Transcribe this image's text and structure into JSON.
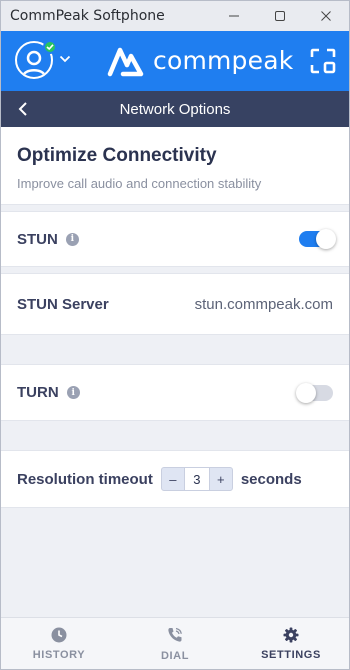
{
  "window": {
    "title": "CommPeak Softphone"
  },
  "header": {
    "brand_name": "commpeak",
    "avatar_icon": "user-avatar-icon",
    "status_color": "#29c45d",
    "accent_color": "#1f7ef0"
  },
  "nav": {
    "title": "Network Options",
    "bar_color": "#374262"
  },
  "intro": {
    "title": "Optimize Connectivity",
    "subtitle": "Improve call audio and connection stability"
  },
  "settings": {
    "stun": {
      "label": "STUN",
      "info_icon": "i",
      "enabled": true
    },
    "stun_server": {
      "label": "STUN Server",
      "value": "stun.commpeak.com"
    },
    "turn": {
      "label": "TURN",
      "info_icon": "i",
      "enabled": false
    },
    "resolution_timeout": {
      "label": "Resolution timeout",
      "decrement": "–",
      "value": "3",
      "increment": "+",
      "unit": "seconds"
    }
  },
  "tabs": [
    {
      "label": "HISTORY",
      "icon": "clock-icon",
      "active": false
    },
    {
      "label": "DIAL",
      "icon": "phone-icon",
      "active": false
    },
    {
      "label": "SETTINGS",
      "icon": "gear-icon",
      "active": true
    }
  ]
}
